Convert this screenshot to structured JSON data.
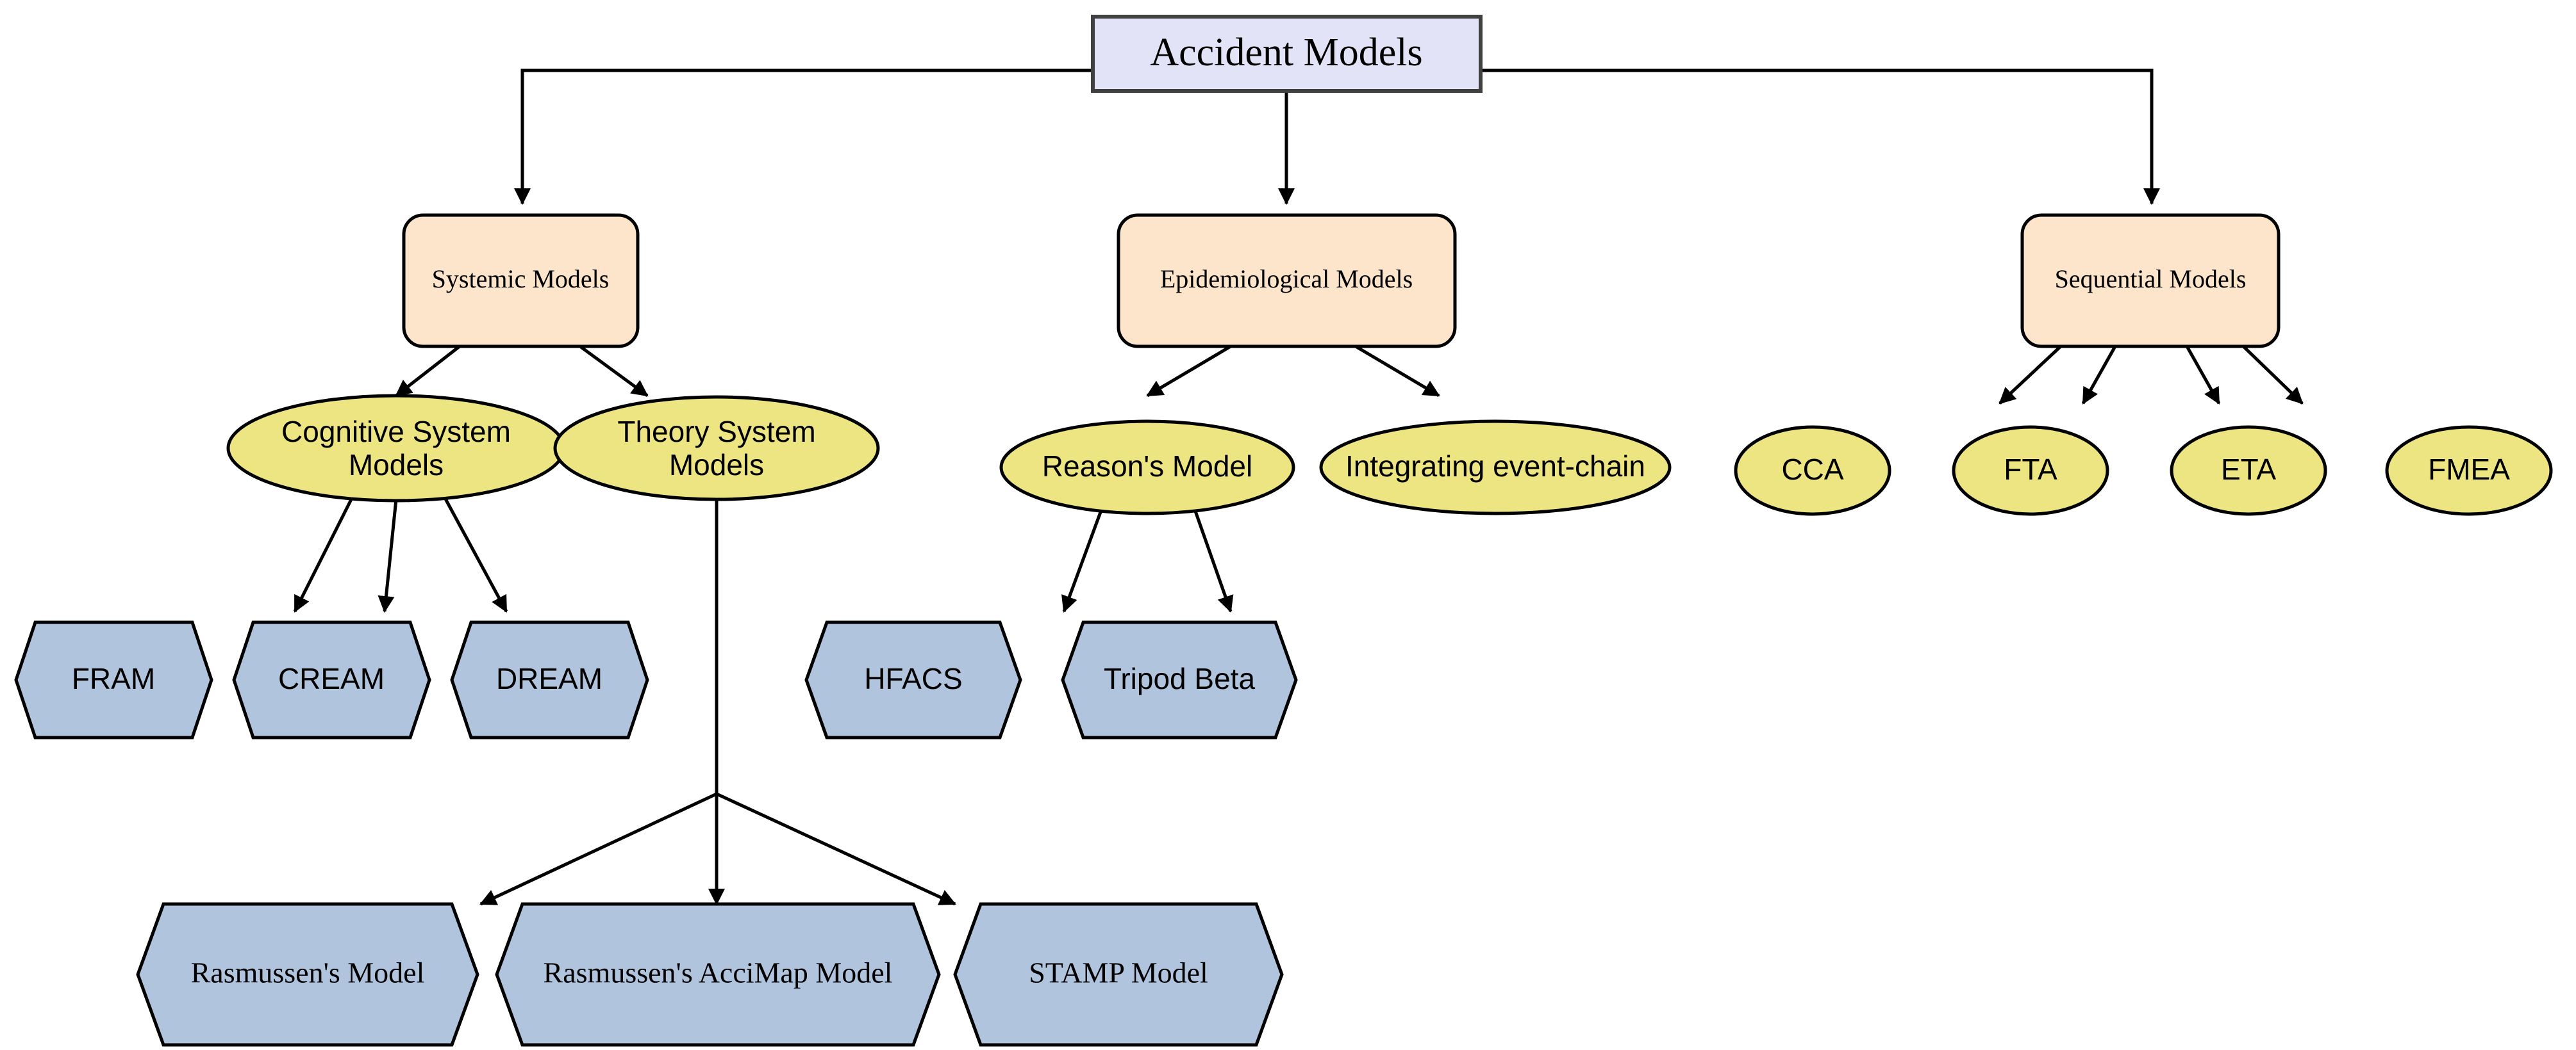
{
  "diagram": {
    "title": "Accident Models",
    "type": "hierarchy-tree",
    "colors": {
      "root_fill": "#e3e3f7",
      "root_stroke": "#404040",
      "category_fill": "#fce5cb",
      "ellipse_fill": "#ece582",
      "hexagon_fill": "#b0c4de",
      "edge_stroke": "#000000",
      "text": "#000000",
      "background": "#ffffff"
    },
    "root": {
      "id": "accident-models",
      "label": "Accident Models",
      "shape": "rectangle"
    },
    "categories": [
      {
        "id": "systemic-models",
        "label": "Systemic Models",
        "shape": "rounded-rectangle"
      },
      {
        "id": "epidemiological-models",
        "label": "Epidemiological Models",
        "shape": "rounded-rectangle"
      },
      {
        "id": "sequential-models",
        "label": "Sequential Models",
        "shape": "rounded-rectangle"
      }
    ],
    "ellipses": [
      {
        "id": "cognitive-system-models",
        "label": "Cognitive System Models",
        "line1": "Cognitive System",
        "line2": "Models",
        "parent": "systemic-models"
      },
      {
        "id": "theory-system-models",
        "label": "Theory System Models",
        "line1": "Theory System",
        "line2": "Models",
        "parent": "systemic-models"
      },
      {
        "id": "reasons-model",
        "label": "Reason's Model",
        "line1": "Reason's Model",
        "line2": "",
        "parent": "epidemiological-models"
      },
      {
        "id": "integrating-event-chain",
        "label": "Integrating event-chain",
        "line1": "Integrating event-chain",
        "line2": "",
        "parent": "epidemiological-models"
      },
      {
        "id": "cca",
        "label": "CCA",
        "line1": "CCA",
        "line2": "",
        "parent": "sequential-models"
      },
      {
        "id": "fta",
        "label": "FTA",
        "line1": "FTA",
        "line2": "",
        "parent": "sequential-models"
      },
      {
        "id": "eta",
        "label": "ETA",
        "line1": "ETA",
        "line2": "",
        "parent": "sequential-models"
      },
      {
        "id": "fmea",
        "label": "FMEA",
        "line1": "FMEA",
        "line2": "",
        "parent": "sequential-models"
      }
    ],
    "hexagons_upper": [
      {
        "id": "fram",
        "label": "FRAM",
        "parent": "cognitive-system-models"
      },
      {
        "id": "cream",
        "label": "CREAM",
        "parent": "cognitive-system-models"
      },
      {
        "id": "dream",
        "label": "DREAM",
        "parent": "cognitive-system-models"
      },
      {
        "id": "hfacs",
        "label": "HFACS",
        "parent": "reasons-model"
      },
      {
        "id": "tripod-beta",
        "label": "Tripod Beta",
        "parent": "reasons-model"
      }
    ],
    "hexagons_lower": [
      {
        "id": "rasmussens-model",
        "label": "Rasmussen's Model",
        "parent": "theory-system-models"
      },
      {
        "id": "rasmussens-accimap-model",
        "label": "Rasmussen's AcciMap Model",
        "parent": "theory-system-models"
      },
      {
        "id": "stamp-model",
        "label": "STAMP Model",
        "parent": "theory-system-models"
      }
    ]
  }
}
